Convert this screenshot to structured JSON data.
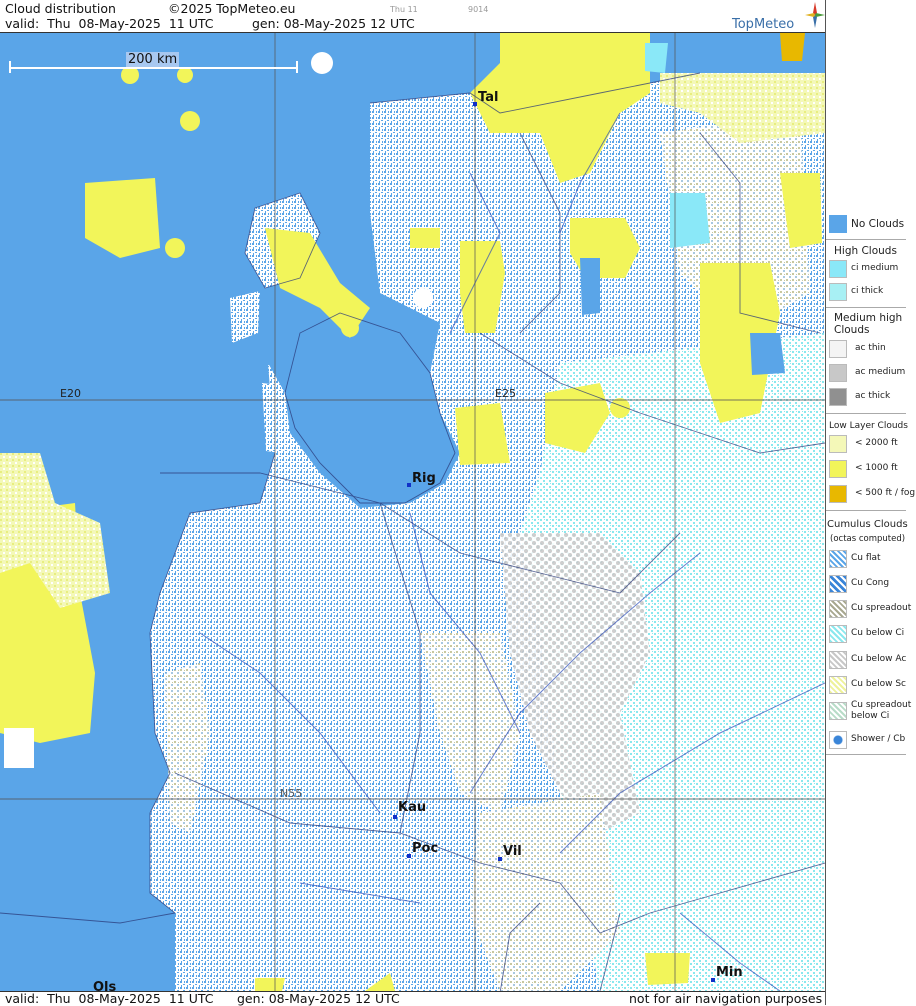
{
  "header": {
    "title": "Cloud distribution",
    "copyright": "©2025 TopMeteo.eu",
    "valid": "valid:  Thu  08-May-2025  11 UTC",
    "gen": "gen: 08-May-2025 12 UTC",
    "tiny_1": "Thu 11",
    "tiny_2": "9014",
    "brand": "TopMeteo"
  },
  "footer": {
    "valid": "valid:  Thu  08-May-2025  11 UTC",
    "gen": "gen: 08-May-2025 12 UTC",
    "disclaimer": "not for air navigation purposes"
  },
  "map": {
    "scale_label": "200 km",
    "grid_labels": {
      "e20": "E20",
      "e25": "E25",
      "n55": "N55"
    },
    "cities": [
      {
        "name": "Tal"
      },
      {
        "name": "Rig"
      },
      {
        "name": "Kau"
      },
      {
        "name": "Poc"
      },
      {
        "name": "Vil"
      },
      {
        "name": "Min"
      },
      {
        "name": "Ols"
      }
    ],
    "colors": {
      "sea": "#5aa5e8",
      "no_clouds": "#5aa5e8",
      "cu_flat": "#ffffff",
      "cu_below_ci": "#a8f0f4",
      "low_yellow": "#f2f55a",
      "pale_yellow": "#f4f8b8",
      "grey_ac": "#c8c8c8"
    }
  },
  "legend": {
    "no_clouds": "No Clouds",
    "high_clouds": "High Clouds",
    "ci_medium": "ci medium",
    "ci_thick": "ci thick",
    "medium_high_1": "Medium high",
    "medium_high_2": "Clouds",
    "ac_thin": "ac thin",
    "ac_medium": "ac medium",
    "ac_thick": "ac thick",
    "low_layer": "Low Layer Clouds",
    "lt2000": "< 2000 ft",
    "lt1000": "< 1000 ft",
    "lt500": "< 500 ft / fog",
    "cumulus_1": "Cumulus Clouds",
    "cumulus_2": "(octas computed)",
    "cu_flat": "Cu flat",
    "cu_cong": "Cu Cong",
    "cu_spreadout": "Cu spreadout",
    "cu_below_ci": "Cu below Ci",
    "cu_below_ac": "Cu below Ac",
    "cu_below_sc": "Cu below Sc",
    "cu_spreadout_ci_1": "Cu spreadout",
    "cu_spreadout_ci_2": "below Ci",
    "shower_cb": "Shower / Cb"
  }
}
